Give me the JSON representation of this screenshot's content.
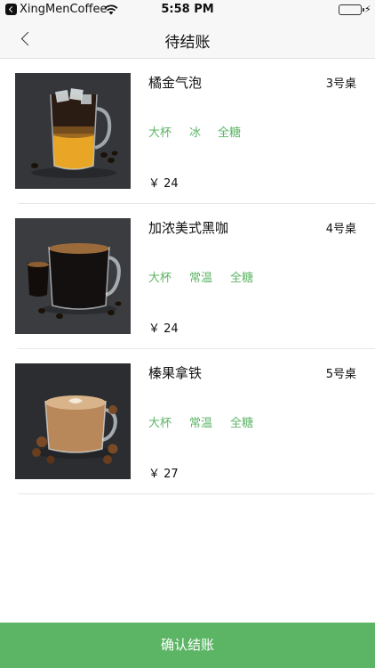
{
  "status_bar": {
    "carrier": "XingMenCoffee",
    "time": "5:58 PM",
    "battery_level": 1.0
  },
  "nav": {
    "title": "待结账"
  },
  "orders": [
    {
      "name": "橘金气泡",
      "table": "3号桌",
      "options": [
        "大杯",
        "冰",
        "全糖"
      ],
      "price": "￥ 24"
    },
    {
      "name": "加浓美式黑咖",
      "table": "4号桌",
      "options": [
        "大杯",
        "常温",
        "全糖"
      ],
      "price": "￥ 24"
    },
    {
      "name": "榛果拿铁",
      "table": "5号桌",
      "options": [
        "大杯",
        "常温",
        "全糖"
      ],
      "price": "￥ 27"
    }
  ],
  "confirm_button": {
    "label": "确认结账"
  },
  "colors": {
    "accent": "#5cb565",
    "battery": "#4cd964"
  },
  "icons": {
    "status_back": "back-to-app-icon",
    "wifi": "wifi-icon",
    "battery": "battery-icon",
    "charging": "bolt-icon",
    "nav_back": "chevron-left-icon"
  }
}
